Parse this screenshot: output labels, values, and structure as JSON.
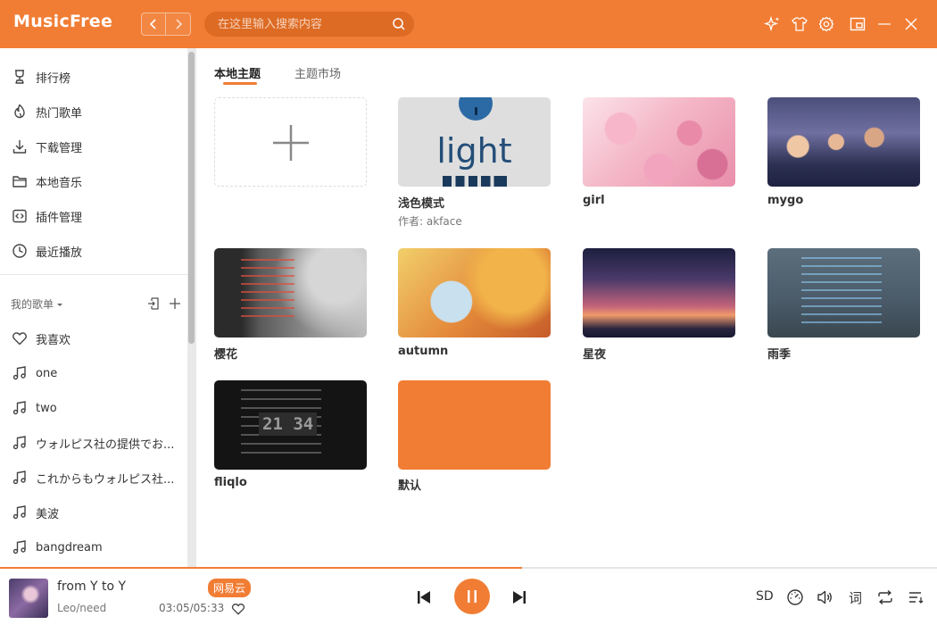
{
  "app": {
    "title": "MusicFree"
  },
  "header": {
    "search_placeholder": "在这里输入搜索内容",
    "back_label": "‹",
    "forward_label": "›"
  },
  "sidebar": {
    "items": [
      {
        "label": "排行榜",
        "icon": "trophy-icon"
      },
      {
        "label": "热门歌单",
        "icon": "fire-icon"
      },
      {
        "label": "下载管理",
        "icon": "download-icon"
      },
      {
        "label": "本地音乐",
        "icon": "folder-icon"
      },
      {
        "label": "插件管理",
        "icon": "plugin-icon"
      },
      {
        "label": "最近播放",
        "icon": "clock-icon"
      }
    ],
    "section_label": "我的歌单",
    "playlists": [
      {
        "label": "我喜欢",
        "icon": "heart-icon"
      },
      {
        "label": "one",
        "icon": "music-note-icon"
      },
      {
        "label": "two",
        "icon": "music-note-icon"
      },
      {
        "label": "ウォルピス社の提供でお...",
        "icon": "music-note-icon"
      },
      {
        "label": "これからもウォルピス社...",
        "icon": "music-note-icon"
      },
      {
        "label": "美波",
        "icon": "music-note-icon"
      },
      {
        "label": "bangdream",
        "icon": "music-note-icon"
      }
    ]
  },
  "main": {
    "tabs": [
      {
        "label": "本地主题",
        "active": true
      },
      {
        "label": "主题市场",
        "active": false
      }
    ],
    "themes": [
      {
        "name": "浅色模式",
        "author": "作者: akface",
        "preview_text": "light"
      },
      {
        "name": "girl"
      },
      {
        "name": "mygo"
      },
      {
        "name": "樱花"
      },
      {
        "name": "autumn"
      },
      {
        "name": "星夜"
      },
      {
        "name": "雨季"
      },
      {
        "name": "fliqlo",
        "preview_text": "21 34"
      },
      {
        "name": "默认"
      }
    ]
  },
  "player": {
    "title": "from Y to Y",
    "artist": "Leo/need",
    "platform": "网易云",
    "time": "03:05/05:33",
    "quality": "SD",
    "lyric_label": "词",
    "progress": 0.557
  },
  "colors": {
    "accent": "#f17d34",
    "accent_dark": "#dd6b24"
  }
}
